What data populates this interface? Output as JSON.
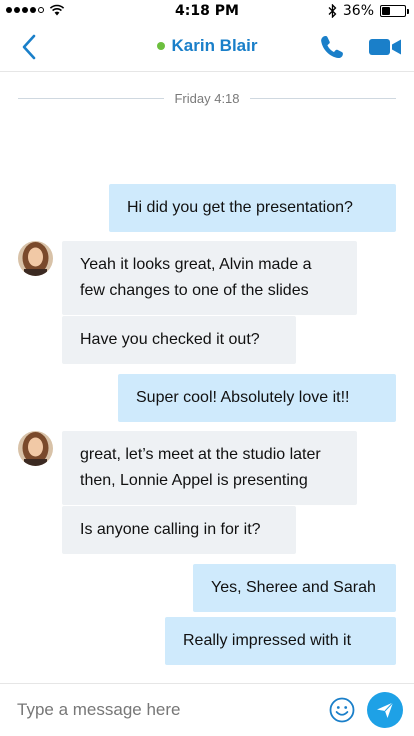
{
  "status_bar": {
    "time": "4:18 PM",
    "battery_text": "36%",
    "battery_level": 0.36,
    "signal_bars_filled": 4,
    "signal_bars_total": 5,
    "icons": [
      "wifi-icon",
      "bluetooth-icon",
      "battery-icon"
    ]
  },
  "header": {
    "contact_name": "Karin Blair",
    "presence_color": "#6cbf3e",
    "accent_color": "#1a7fc9",
    "icons": [
      "back-chevron-icon",
      "phone-icon",
      "video-camera-icon"
    ]
  },
  "divider": {
    "label": "Friday 4:18"
  },
  "messages": [
    {
      "direction": "outgoing",
      "text": "Hi did you get the presentation?"
    },
    {
      "direction": "incoming",
      "text": "Yeah it looks great, Alvin made a few changes to one of the slides"
    },
    {
      "direction": "incoming",
      "text": "Have you checked it out?"
    },
    {
      "direction": "outgoing",
      "text": "Super cool! Absolutely love it!!"
    },
    {
      "direction": "incoming",
      "text": "great, let’s meet at the studio later then, Lonnie Appel is presenting"
    },
    {
      "direction": "incoming",
      "text": "Is anyone calling in for it?"
    },
    {
      "direction": "outgoing",
      "text": "Yes, Sheree and Sarah"
    },
    {
      "direction": "outgoing",
      "text": "Really impressed with it"
    }
  ],
  "composer": {
    "placeholder": "Type a message here",
    "value": "",
    "icons": [
      "emoji-icon",
      "send-icon"
    ]
  },
  "colors": {
    "outgoing_bubble": "#cfeafc",
    "incoming_bubble": "#eef1f4",
    "send_button": "#1ea1e6"
  }
}
